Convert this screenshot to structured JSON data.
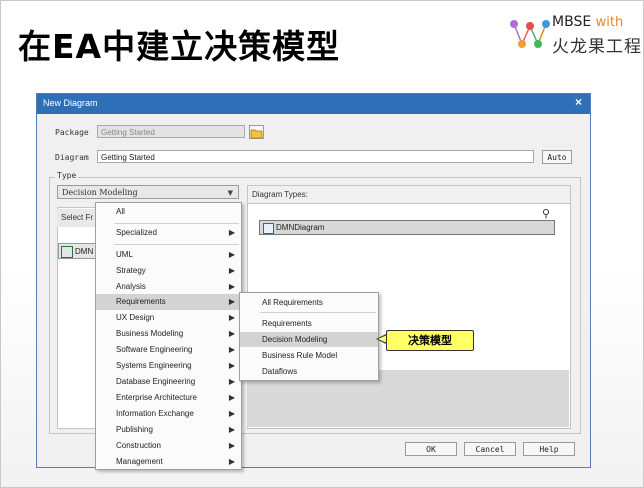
{
  "slide": {
    "title": "在EA中建立决策模型",
    "logo_line1": "MBSE",
    "logo_with": "with",
    "logo_line2": "火龙果工程"
  },
  "dialog": {
    "title": "New Diagram",
    "close": "×",
    "package_label": "Package",
    "package_value": "Getting Started",
    "diagram_label": "Diagram",
    "diagram_value": "Getting Started",
    "auto_button": "Auto",
    "type_label": "Type",
    "type_combo": "Decision Modeling",
    "select_from": "Select Fr",
    "left_item": "DMN",
    "diagram_types_header": "Diagram Types:",
    "diagram_type_item": "DMNDiagram",
    "ok": "OK",
    "cancel": "Cancel",
    "help": "Help"
  },
  "menu": {
    "items": [
      "All",
      "Specialized",
      "UML",
      "Strategy",
      "Analysis",
      "Requirements",
      "UX Design",
      "Business Modeling",
      "Software Engineering",
      "Systems Engineering",
      "Database Engineering",
      "Enterprise Architecture",
      "Information Exchange",
      "Publishing",
      "Construction",
      "Management"
    ],
    "highlighted": "Requirements"
  },
  "submenu": {
    "items": [
      "All Requirements",
      "Requirements",
      "Decision Modeling",
      "Business Rule Model",
      "Dataflows"
    ],
    "highlighted": "Decision Modeling"
  },
  "callout": "决策模型",
  "colors": {
    "titlebar": "#2e6fb8",
    "highlight": "#d3d3d3",
    "callout": "#ffff66"
  }
}
